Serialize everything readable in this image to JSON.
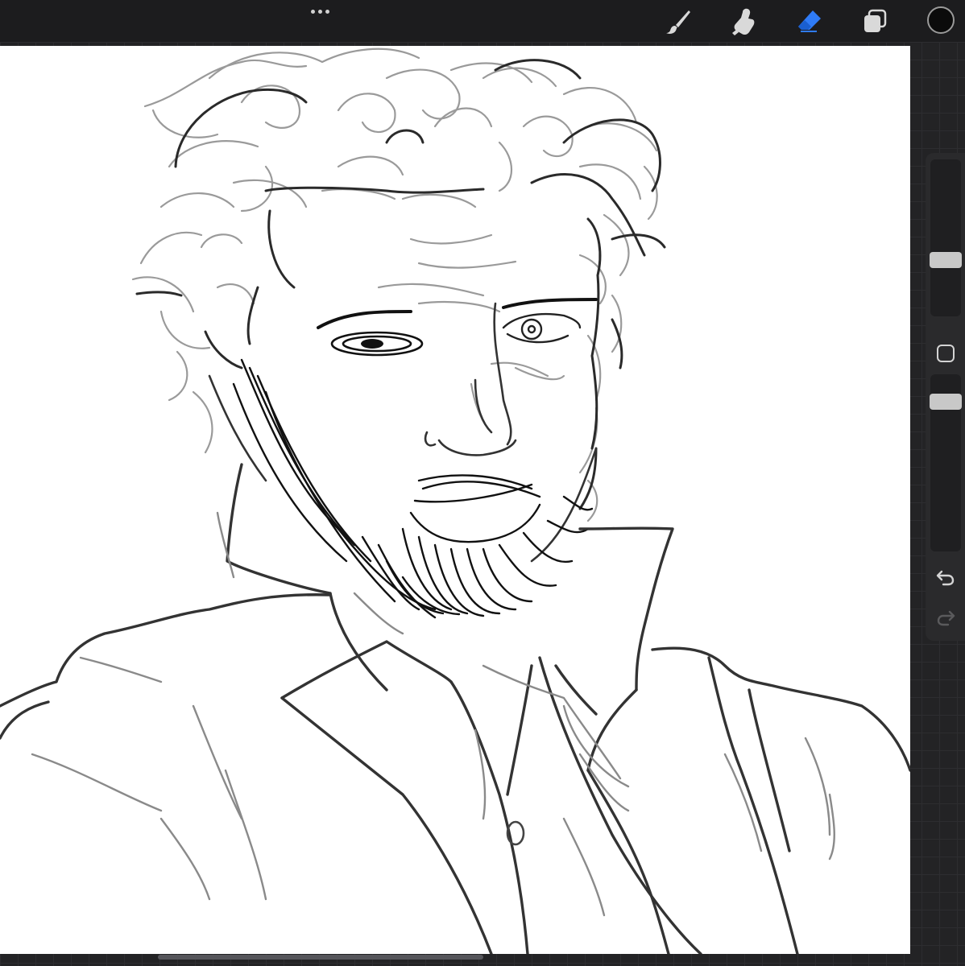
{
  "toolbar": {
    "more_icon": "ellipsis-icon",
    "tools": [
      {
        "name": "brush",
        "icon": "paintbrush-icon",
        "active": false
      },
      {
        "name": "smudge",
        "icon": "smudge-finger-icon",
        "active": false
      },
      {
        "name": "eraser",
        "icon": "eraser-icon",
        "active": true
      },
      {
        "name": "layers",
        "icon": "layers-icon",
        "active": false
      }
    ],
    "current_color": "#0b0b0b"
  },
  "sidebar": {
    "brush_size_icon": "size-slider",
    "opacity_icon": "opacity-slider",
    "modify_icon": "square-modify-icon",
    "undo_icon": "undo-arrow-icon",
    "redo_icon": "redo-arrow-icon",
    "redo_enabled": false
  },
  "colors": {
    "accent": "#2f7bf6",
    "icon_default": "#d9d9d9",
    "chrome": "#1c1c1e",
    "canvas": "#ffffff"
  }
}
